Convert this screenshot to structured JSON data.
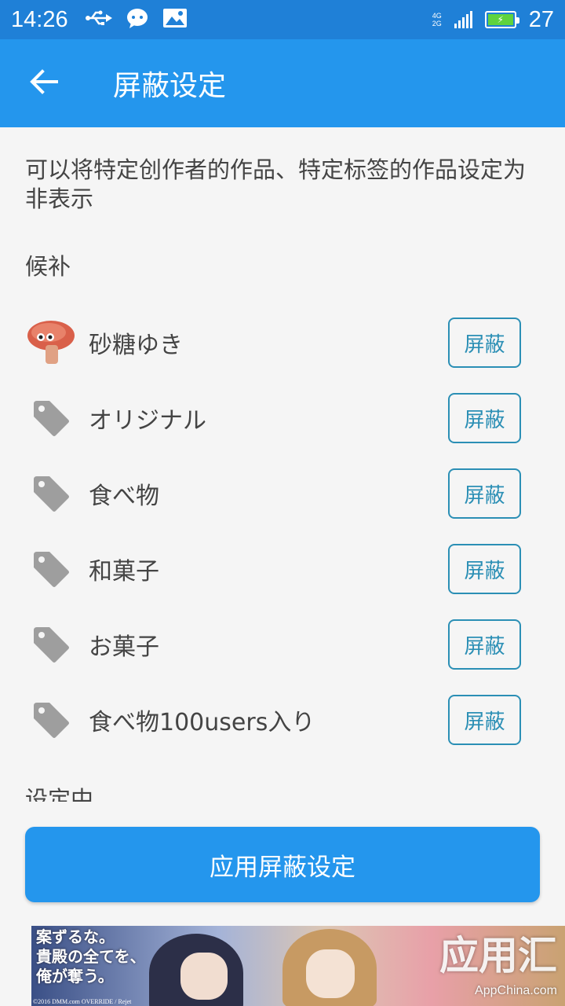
{
  "status_bar": {
    "time": "14:26",
    "network_top": "4G",
    "network_bottom": "2G",
    "battery_level": "27",
    "icons": [
      "usb-icon",
      "chat-bubble-icon",
      "image-icon",
      "signal-icon",
      "battery-icon"
    ]
  },
  "app_bar": {
    "title": "屏蔽设定",
    "back_icon": "arrow-left-icon"
  },
  "description": "可以将特定创作者的作品、特定标签的作品设定为非表示",
  "candidates": {
    "section_title": "候补",
    "items": [
      {
        "label": "砂糖ゆき",
        "icon": "user-avatar",
        "button": "屏蔽"
      },
      {
        "label": "オリジナル",
        "icon": "tag-icon",
        "button": "屏蔽"
      },
      {
        "label": "食べ物",
        "icon": "tag-icon",
        "button": "屏蔽"
      },
      {
        "label": "和菓子",
        "icon": "tag-icon",
        "button": "屏蔽"
      },
      {
        "label": "お菓子",
        "icon": "tag-icon",
        "button": "屏蔽"
      },
      {
        "label": "食べ物100users入り",
        "icon": "tag-icon",
        "button": "屏蔽"
      }
    ]
  },
  "settings_section_title": "设定中",
  "apply_button": "应用屏蔽设定",
  "ad": {
    "text_left": [
      "案ずるな。",
      "貴殿の全てを、",
      "俺が奪う。"
    ],
    "credit": "©2016 DMM.com OVERRIDE / Rejet",
    "watermark_title": "应用汇",
    "watermark_sub": "AppChina.com"
  },
  "colors": {
    "status_bar": "#1f80d7",
    "app_bar": "#2496ed",
    "button_outline": "#2b8fb5",
    "tag_icon": "#9e9e9e"
  }
}
